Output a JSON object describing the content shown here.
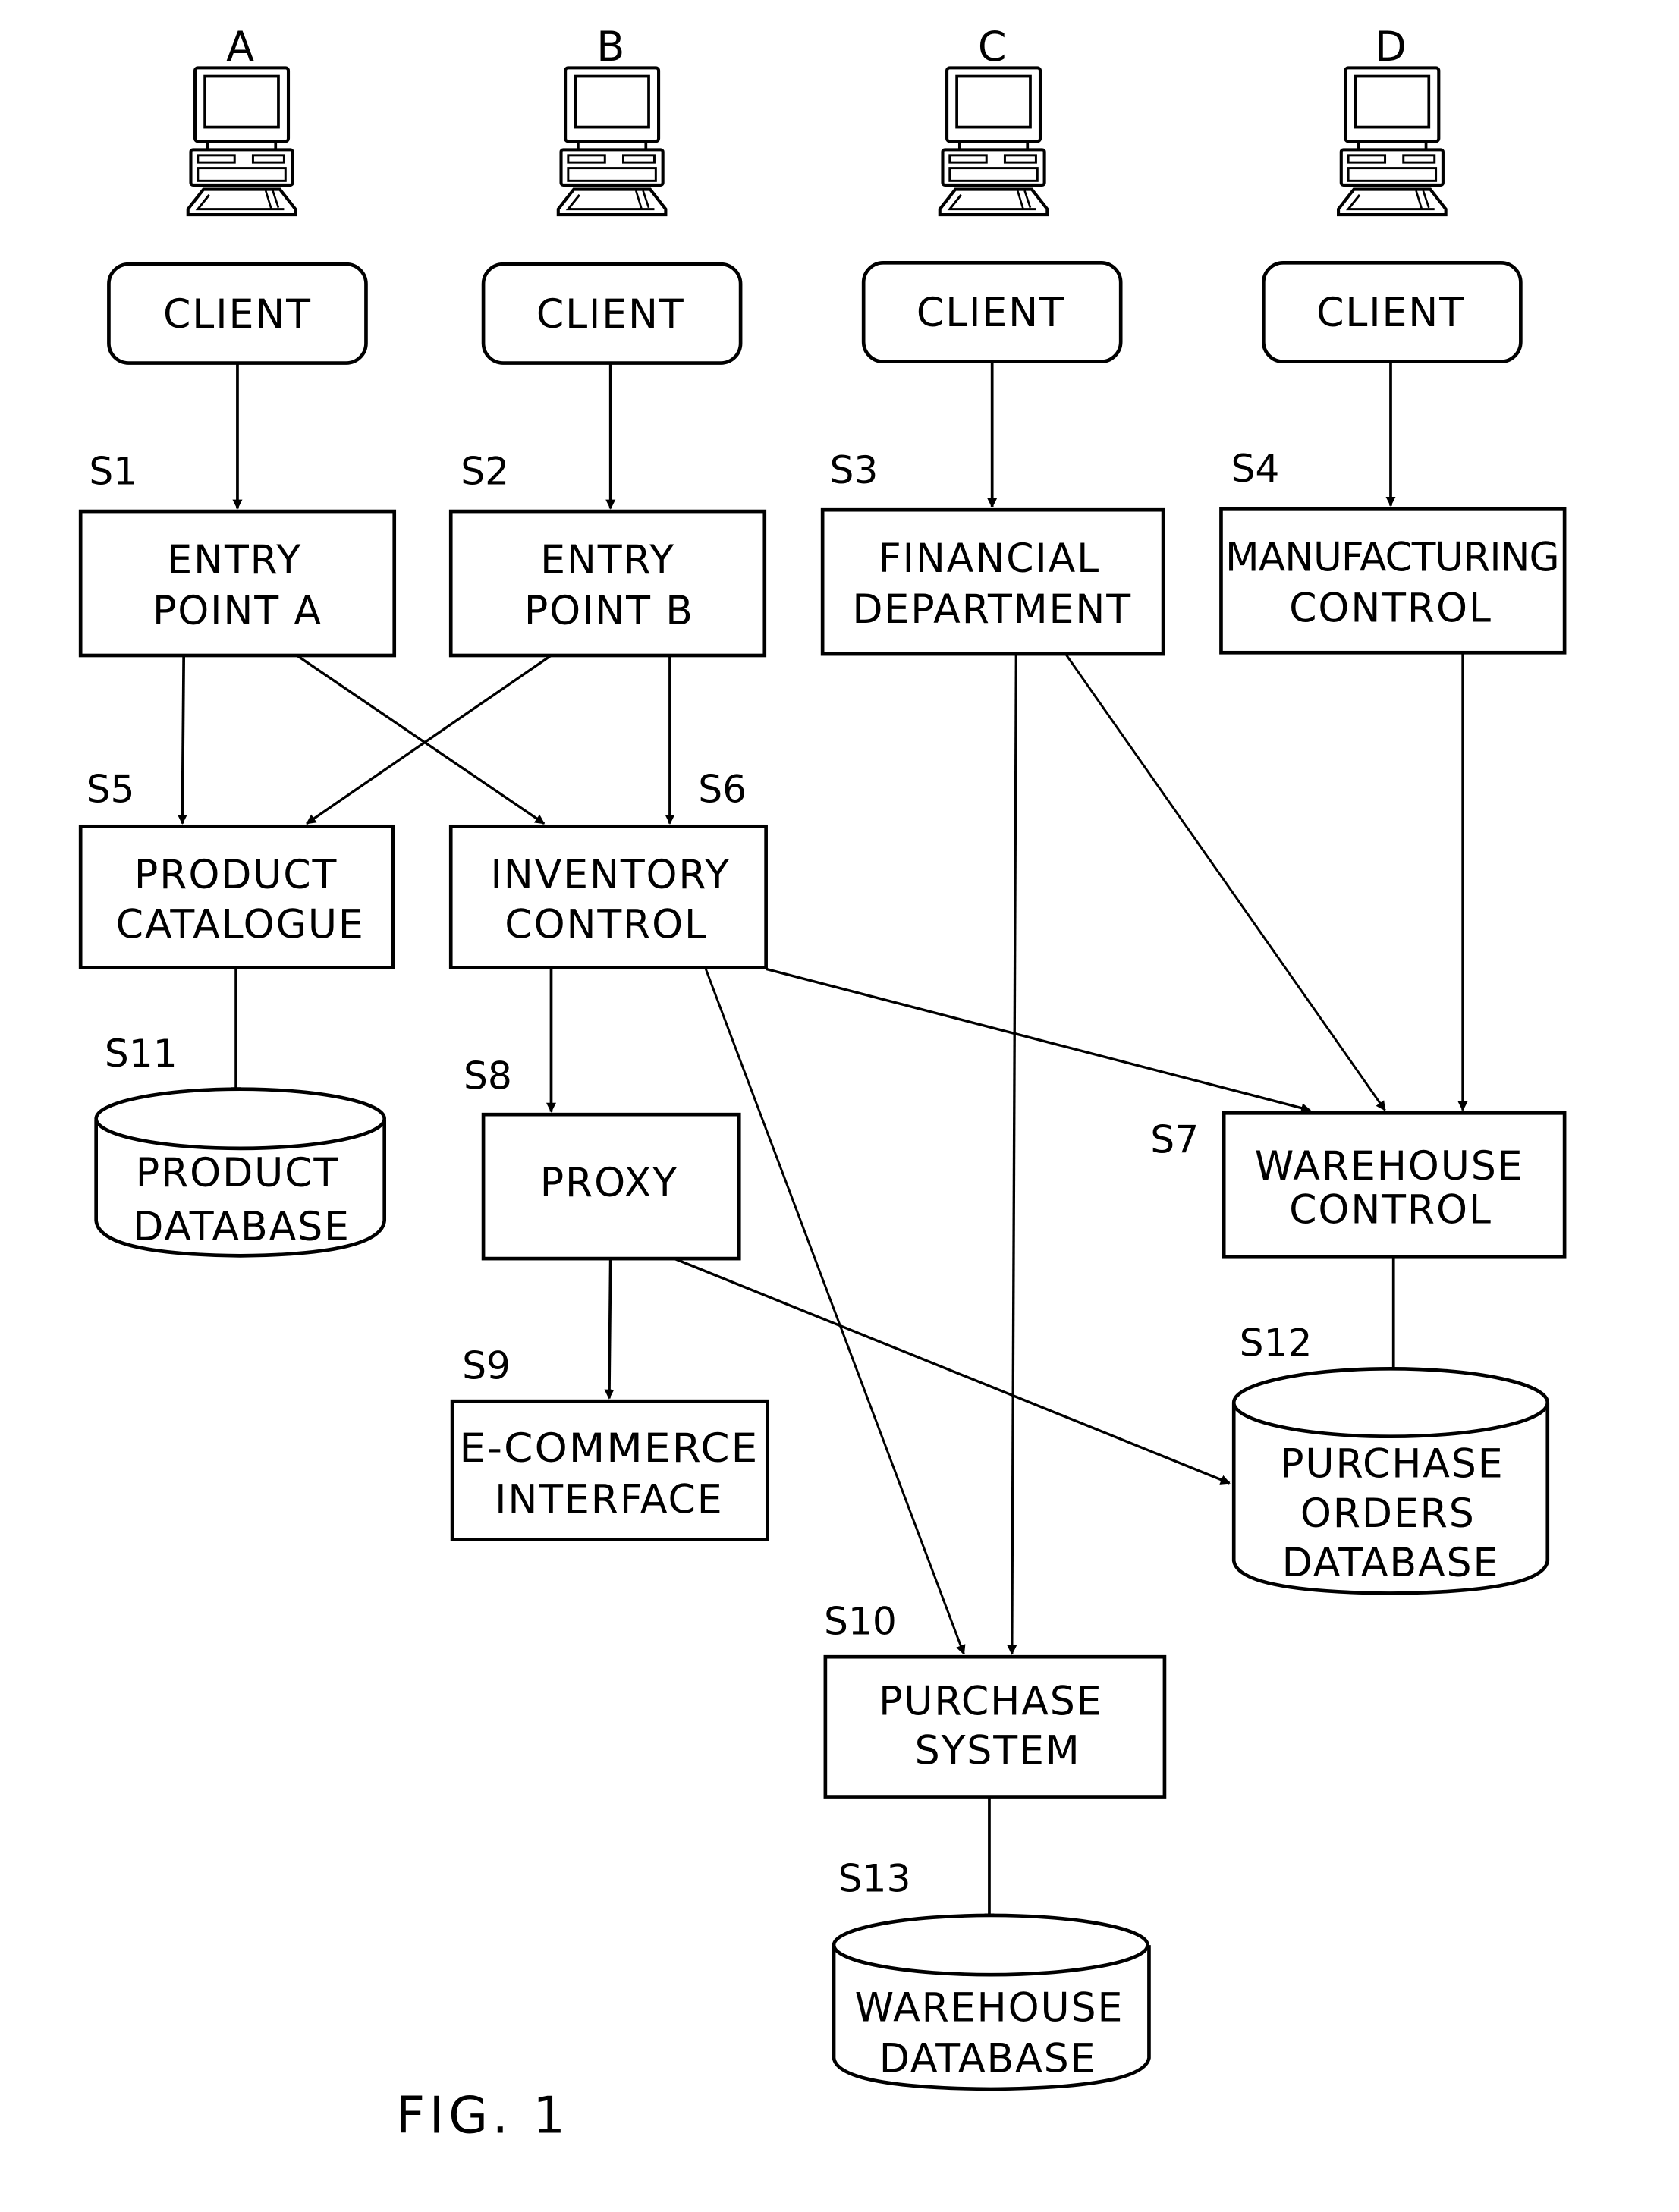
{
  "figure_label": "FIG. 1",
  "colors": {
    "ink": "#000000",
    "paper": "#ffffff"
  },
  "clients": [
    {
      "id": "A",
      "letter": "A",
      "label": "CLIENT",
      "icon": "desktop-computer-icon"
    },
    {
      "id": "B",
      "letter": "B",
      "label": "CLIENT",
      "icon": "desktop-computer-icon"
    },
    {
      "id": "C",
      "letter": "C",
      "label": "CLIENT",
      "icon": "desktop-computer-icon"
    },
    {
      "id": "D",
      "letter": "D",
      "label": "CLIENT",
      "icon": "desktop-computer-icon"
    }
  ],
  "nodes": {
    "S1": {
      "step": "S1",
      "shape": "box",
      "lines": [
        "ENTRY",
        "POINT A"
      ]
    },
    "S2": {
      "step": "S2",
      "shape": "box",
      "lines": [
        "ENTRY",
        "POINT B"
      ]
    },
    "S3": {
      "step": "S3",
      "shape": "box",
      "lines": [
        "FINANCIAL",
        "DEPARTMENT"
      ]
    },
    "S4": {
      "step": "S4",
      "shape": "box",
      "lines": [
        "MANUFACTURING",
        "CONTROL"
      ]
    },
    "S5": {
      "step": "S5",
      "shape": "box",
      "lines": [
        "PRODUCT",
        "CATALOGUE"
      ]
    },
    "S6": {
      "step": "S6",
      "shape": "box",
      "lines": [
        "INVENTORY",
        "CONTROL"
      ]
    },
    "S7": {
      "step": "S7",
      "shape": "box",
      "lines": [
        "WAREHOUSE",
        "CONTROL"
      ]
    },
    "S8": {
      "step": "S8",
      "shape": "box",
      "lines": [
        "PROXY"
      ]
    },
    "S9": {
      "step": "S9",
      "shape": "box",
      "lines": [
        "E-COMMERCE",
        "INTERFACE"
      ]
    },
    "S10": {
      "step": "S10",
      "shape": "box",
      "lines": [
        "PURCHASE",
        "SYSTEM"
      ]
    },
    "S11": {
      "step": "S11",
      "shape": "cylinder",
      "lines": [
        "PRODUCT",
        "DATABASE"
      ]
    },
    "S12": {
      "step": "S12",
      "shape": "cylinder",
      "lines": [
        "PURCHASE",
        "ORDERS",
        "DATABASE"
      ]
    },
    "S13": {
      "step": "S13",
      "shape": "cylinder",
      "lines": [
        "WAREHOUSE",
        "DATABASE"
      ]
    }
  },
  "edges": [
    {
      "from": "client-A",
      "to": "S1"
    },
    {
      "from": "client-B",
      "to": "S2"
    },
    {
      "from": "client-C",
      "to": "S3"
    },
    {
      "from": "client-D",
      "to": "S4"
    },
    {
      "from": "S1",
      "to": "S5"
    },
    {
      "from": "S1",
      "to": "S6"
    },
    {
      "from": "S2",
      "to": "S5"
    },
    {
      "from": "S2",
      "to": "S6"
    },
    {
      "from": "S3",
      "to": "S10"
    },
    {
      "from": "S3",
      "to": "S7"
    },
    {
      "from": "S4",
      "to": "S7"
    },
    {
      "from": "S5",
      "to": "S11"
    },
    {
      "from": "S6",
      "to": "S8"
    },
    {
      "from": "S6",
      "to": "S7"
    },
    {
      "from": "S6",
      "to": "S10"
    },
    {
      "from": "S8",
      "to": "S9"
    },
    {
      "from": "S8",
      "to": "S12"
    },
    {
      "from": "S7",
      "to": "S12"
    },
    {
      "from": "S10",
      "to": "S13"
    }
  ]
}
